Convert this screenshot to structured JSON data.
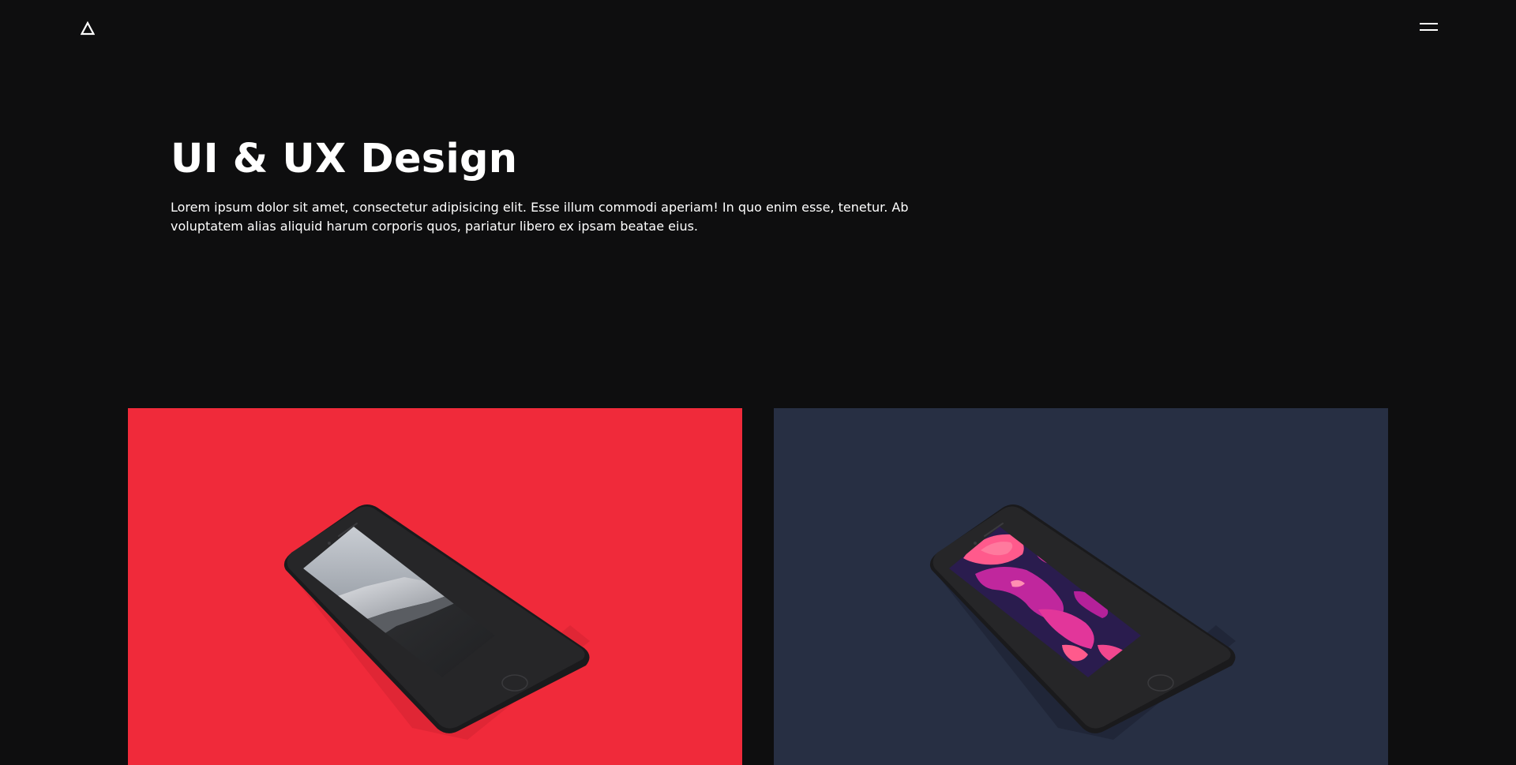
{
  "header": {
    "logo_icon": "triangle-logo-icon",
    "menu_icon": "hamburger-menu-icon"
  },
  "hero": {
    "title": "UI & UX Design",
    "description": "Lorem ipsum dolor sit amet, consectetur adipisicing elit. Esse illum commodi aperiam! In quo enim esse, tenetur. Ab voluptatem alias aliquid harum corporis quos, pariatur libero ex ipsam beatae eius."
  },
  "colors": {
    "background": "#0e0e0f",
    "text": "#ffffff",
    "card_red": "#f02a3a",
    "card_navy": "#272f43"
  },
  "projects": [
    {
      "background": "#f02a3a",
      "image": "phone-mockup-beach-screen"
    },
    {
      "background": "#272f43",
      "image": "phone-mockup-abstract-paint-screen"
    }
  ]
}
